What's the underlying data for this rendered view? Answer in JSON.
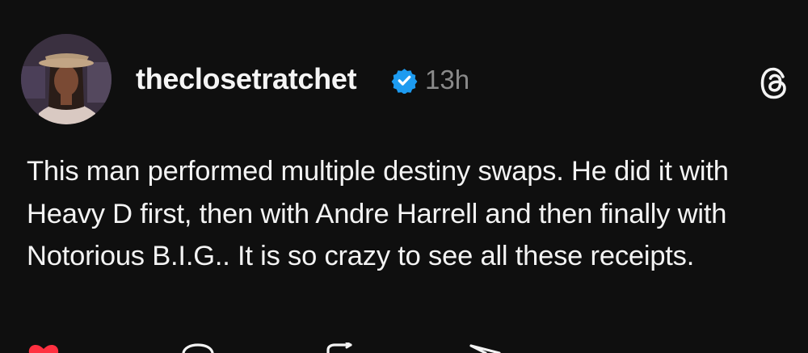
{
  "post": {
    "username": "theclosetratchet",
    "timestamp": "13h",
    "body": "This man performed multiple destiny swaps. He did it with Heavy D first, then with Andre Harrell and then finally with Notorious B.I.G.. It is so crazy to see all these receipts."
  },
  "icons": {
    "verified": "verified-badge-icon",
    "threads": "threads-logo-icon",
    "like": "heart-icon",
    "comment": "comment-icon",
    "repost": "repost-icon",
    "share": "share-icon"
  },
  "colors": {
    "background": "#0f0f0f",
    "text": "#f3f3f3",
    "muted": "#8a8a8a",
    "verified": "#1d9bf0",
    "like": "#ff3040"
  }
}
